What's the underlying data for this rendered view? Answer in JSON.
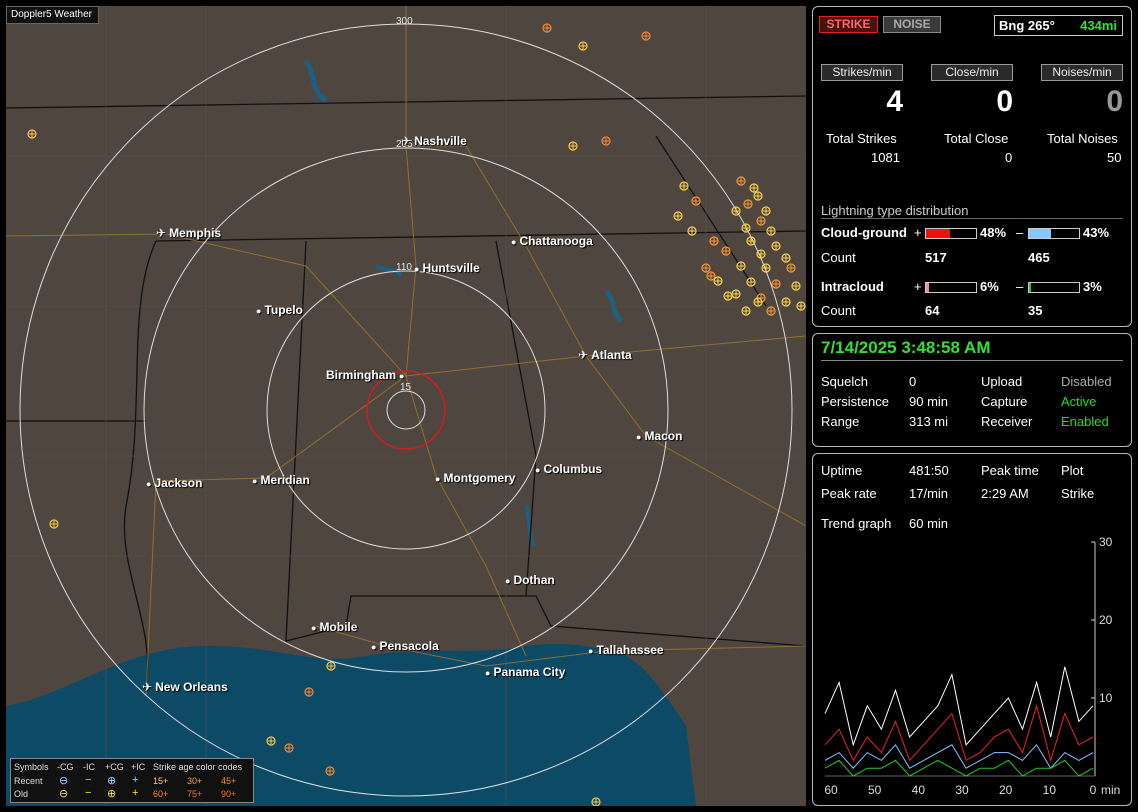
{
  "app_title": "Doppler5 Weather",
  "map": {
    "range_labels": [
      "300",
      "205",
      "110",
      "15"
    ],
    "cities": [
      {
        "name": "Nashville",
        "airport": true
      },
      {
        "name": "Memphis",
        "airport": true
      },
      {
        "name": "Chattanooga",
        "airport": false
      },
      {
        "name": "Huntsville",
        "airport": false
      },
      {
        "name": "Tupelo",
        "airport": false
      },
      {
        "name": "Birmingham",
        "airport": false
      },
      {
        "name": "Atlanta",
        "airport": true
      },
      {
        "name": "Macon",
        "airport": false
      },
      {
        "name": "Jackson",
        "airport": false
      },
      {
        "name": "Meridian",
        "airport": false
      },
      {
        "name": "Montgomery",
        "airport": false
      },
      {
        "name": "Columbus",
        "airport": false
      },
      {
        "name": "Dothan",
        "airport": false
      },
      {
        "name": "Mobile",
        "airport": false
      },
      {
        "name": "Pensacola",
        "airport": false
      },
      {
        "name": "Tallahassee",
        "airport": false
      },
      {
        "name": "Panama City",
        "airport": false
      },
      {
        "name": "New Orleans",
        "airport": true
      }
    ],
    "legend": {
      "symbols_label": "Symbols",
      "recent_label": "Recent",
      "old_label": "Old",
      "types": [
        "-CG",
        "-IC",
        "+CG",
        "+IC"
      ],
      "age_title": "Strike age color codes",
      "recent_ages": [
        "15+",
        "30+",
        "45+"
      ],
      "old_ages": [
        "60+",
        "75+",
        "90+"
      ]
    }
  },
  "top_panel": {
    "strike_button": "STRIKE",
    "noise_button": "NOISE",
    "bearing": "Bng 265°",
    "distance": "434mi",
    "rate_headers": [
      "Strikes/min",
      "Close/min",
      "Noises/min"
    ],
    "rates": [
      "4",
      "0",
      "0"
    ],
    "total_labels": [
      "Total Strikes",
      "Total Close",
      "Total Noises"
    ],
    "totals": [
      "1081",
      "0",
      "50"
    ],
    "distribution_title": "Lightning type distribution",
    "cloud_ground_label": "Cloud-ground",
    "intracloud_label": "Intracloud",
    "count_label": "Count",
    "plus_sign": "+",
    "minus_sign": "–",
    "cg_pos_pct": "48%",
    "cg_neg_pct": "43%",
    "cg_pos_count": "517",
    "cg_neg_count": "465",
    "ic_pos_pct": "6%",
    "ic_neg_pct": "3%",
    "ic_pos_count": "64",
    "ic_neg_count": "35",
    "cg_pos_frac": 0.48,
    "cg_neg_frac": 0.43,
    "ic_pos_frac": 0.06,
    "ic_neg_frac": 0.03,
    "colors": {
      "cg_pos": "#ee1111",
      "cg_neg": "#88c8ff",
      "ic_pos": "#ee88bb",
      "ic_neg": "#22cc22"
    }
  },
  "status_panel": {
    "datetime": "7/14/2025 3:48:58 AM",
    "rows": [
      {
        "label": "Squelch",
        "value": "0",
        "label2": "Upload",
        "value2": "Disabled",
        "value2_color": "#aaaaaa"
      },
      {
        "label": "Persistence",
        "value": "90 min",
        "label2": "Capture",
        "value2": "Active",
        "value2_color": "#22dd22"
      },
      {
        "label": "Range",
        "value": "313 mi",
        "label2": "Receiver",
        "value2": "Enabled",
        "value2_color": "#22dd22"
      }
    ]
  },
  "stats_panel": {
    "uptime_label": "Uptime",
    "uptime": "481:50",
    "peak_time_label": "Peak time",
    "peak_time": "2:29 AM",
    "plot_label": "Plot",
    "plot_value": "Strike",
    "peak_rate_label": "Peak rate",
    "peak_rate": "17/min",
    "trend_label": "Trend graph",
    "trend_value": "60 min",
    "y_ticks": [
      "30",
      "20",
      "10"
    ],
    "x_ticks": [
      "60",
      "50",
      "40",
      "30",
      "20",
      "10",
      "0"
    ],
    "x_unit": "min"
  },
  "chart_data": {
    "type": "line",
    "xlabel": "min",
    "x": [
      60,
      50,
      40,
      30,
      20,
      10,
      0
    ],
    "ylim": [
      0,
      30
    ],
    "series": [
      {
        "color": "#ffffff",
        "values": [
          8,
          12,
          4,
          9,
          6,
          11,
          5,
          7,
          9,
          13,
          4,
          6,
          8,
          10,
          6,
          12,
          5,
          14,
          7,
          9
        ]
      },
      {
        "color": "#ee2222",
        "values": [
          4,
          6,
          2,
          5,
          3,
          7,
          2,
          4,
          6,
          8,
          2,
          3,
          5,
          6,
          3,
          9,
          2,
          8,
          4,
          5
        ]
      },
      {
        "color": "#88c8ff",
        "values": [
          2,
          3,
          1,
          3,
          2,
          4,
          1,
          2,
          3,
          4,
          1,
          2,
          3,
          3,
          2,
          4,
          1,
          3,
          2,
          3
        ]
      },
      {
        "color": "#22cc22",
        "values": [
          1,
          2,
          0,
          1,
          1,
          2,
          0,
          1,
          2,
          1,
          0,
          1,
          1,
          2,
          0,
          1,
          1,
          2,
          0,
          1
        ]
      }
    ]
  }
}
